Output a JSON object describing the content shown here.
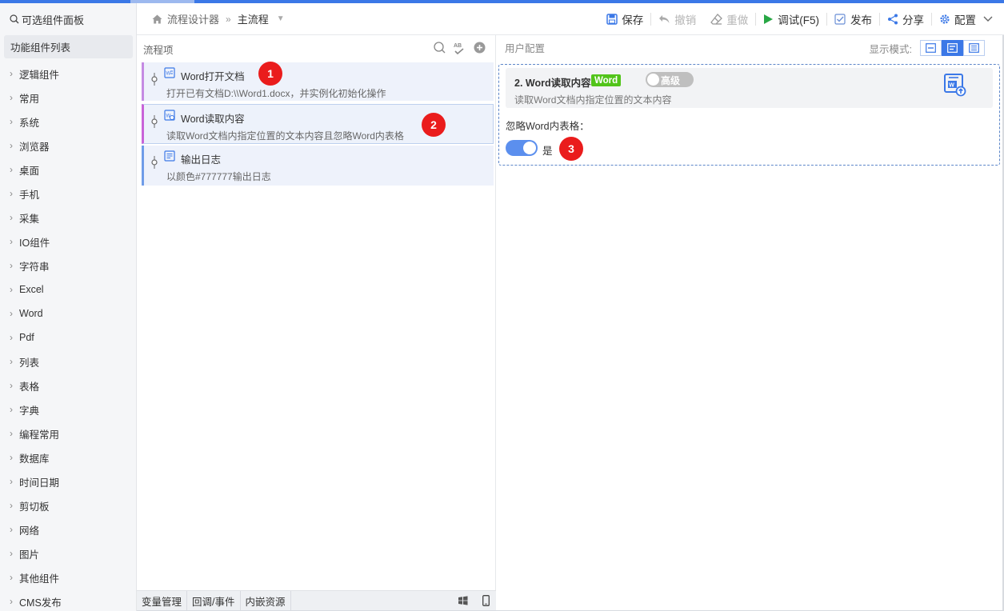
{
  "sidebar": {
    "search_label": "可选组件面板",
    "list_header": "功能组件列表",
    "items": [
      {
        "label": "逻辑组件"
      },
      {
        "label": "常用"
      },
      {
        "label": "系统"
      },
      {
        "label": "浏览器"
      },
      {
        "label": "桌面"
      },
      {
        "label": "手机"
      },
      {
        "label": "采集"
      },
      {
        "label": "IO组件"
      },
      {
        "label": "字符串"
      },
      {
        "label": "Excel"
      },
      {
        "label": "Word"
      },
      {
        "label": "Pdf"
      },
      {
        "label": "列表"
      },
      {
        "label": "表格"
      },
      {
        "label": "字典"
      },
      {
        "label": "编程常用"
      },
      {
        "label": "数据库"
      },
      {
        "label": "时间日期"
      },
      {
        "label": "剪切板"
      },
      {
        "label": "网络"
      },
      {
        "label": "图片"
      },
      {
        "label": "其他组件"
      },
      {
        "label": "CMS发布"
      }
    ]
  },
  "breadcrumb": {
    "root": "流程设计器",
    "current": "主流程"
  },
  "toolbar": {
    "save": "保存",
    "undo": "撤销",
    "redo": "重做",
    "debug": "调试(F5)",
    "publish": "发布",
    "share": "分享",
    "config": "配置"
  },
  "flow": {
    "header": "流程项",
    "steps": [
      {
        "title": "Word打开文档",
        "desc": "打开已有文档D:\\\\Word1.docx，并实例化初始化操作",
        "badge": "1"
      },
      {
        "title": "Word读取内容",
        "desc": "读取Word文档内指定位置的文本内容且忽略Word内表格",
        "badge": "2"
      },
      {
        "title": "输出日志",
        "desc": "以颜色#777777输出日志"
      }
    ],
    "bottom_tabs": [
      "变量管理",
      "回调/事件",
      "内嵌资源"
    ]
  },
  "config": {
    "header": "用户配置",
    "display_mode_label": "显示模式:",
    "component": {
      "title": "2. Word读取内容",
      "tag": "Word",
      "advanced": "高级",
      "desc": "读取Word文档内指定位置的文本内容"
    },
    "field_label": "忽略Word内表格：",
    "toggle_text": "是",
    "badge": "3"
  }
}
